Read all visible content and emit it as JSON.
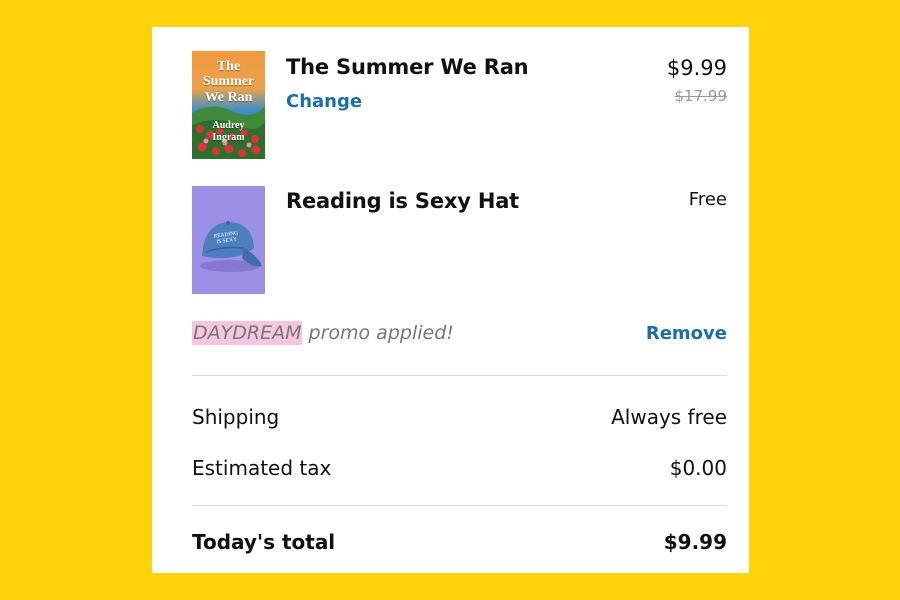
{
  "cart": {
    "items": [
      {
        "title": "The Summer We Ran",
        "change_label": "Change",
        "price": "$9.99",
        "original_price": "$17.99",
        "cover_lines": [
          "The",
          "Summer",
          "We Ran"
        ],
        "cover_author": [
          "Audrey",
          "Ingram"
        ]
      },
      {
        "title": "Reading is Sexy Hat",
        "price": "Free",
        "hat_text": [
          "READING",
          "IS SEXY"
        ]
      }
    ],
    "promo": {
      "code": "DAYDREAM",
      "message": "promo applied!",
      "remove_label": "Remove"
    },
    "summary": {
      "shipping_label": "Shipping",
      "shipping_value": "Always free",
      "tax_label": "Estimated tax",
      "tax_value": "$0.00",
      "total_label": "Today's total",
      "total_value": "$9.99"
    }
  },
  "colors": {
    "background": "#FFD20A",
    "link": "#1C6FA6",
    "promo_highlight": "#F7C6DE",
    "hat_bg": "#9B8FE6"
  }
}
